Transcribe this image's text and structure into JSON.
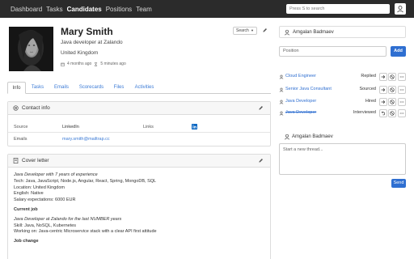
{
  "navbar": {
    "links": [
      "Dashboard",
      "Tasks",
      "Candidates",
      "Positions",
      "Team"
    ],
    "active": "Candidates",
    "search_placeholder": "Press S to search"
  },
  "profile": {
    "name": "Mary Smith",
    "headline": "Java developer at Zalando",
    "location": "United Kingdom",
    "created": "4 months ago",
    "updated": "5 minutes ago",
    "search_select": "Search"
  },
  "tabs": [
    "Info",
    "Tasks",
    "Emails",
    "Scorecards",
    "Files",
    "Activities"
  ],
  "contact": {
    "title": "Contact info",
    "source_label": "Source",
    "source_value": "LinkedIn",
    "links_label": "Links",
    "emails_label": "Emails",
    "email_value": "mary.smith@mailtrap.cc"
  },
  "cover": {
    "title": "Cover letter",
    "lines": [
      "Java Developer with 7 years of experience",
      "Tech: Java, JavaScript, Node.js, Angular, React, Spring, MongoDB, SQL",
      "Location: United Kingdom",
      "English: Native",
      "Salary expectations: 6000 EUR",
      "Current job",
      "Java Developer at Zalando for the last NUMBER years",
      "Skill: Java, NoSQL, Kubernetes",
      "Working on: Java-centric Microservice stack with a clear API first attitude",
      "Job change"
    ]
  },
  "right": {
    "owner": "Amgalan Badmaev",
    "position_placeholder": "Position",
    "add_label": "Add",
    "pipeline": [
      {
        "job": "Cloud Engineer",
        "status": "Replied",
        "strike": false
      },
      {
        "job": "Senior Java Consultant",
        "status": "Sourced",
        "strike": false
      },
      {
        "job": "Java Developer",
        "status": "Hired",
        "strike": false
      },
      {
        "job": "Java Developer",
        "status": "Interviewed",
        "strike": true
      }
    ],
    "thread_user": "Amgalan Badmaev",
    "thread_placeholder": "Start a new thread...",
    "send_label": "Send"
  },
  "colors": {
    "navbar": "#2b2b2b",
    "accent": "#2f6fd1",
    "link": "#3c7bd6"
  }
}
